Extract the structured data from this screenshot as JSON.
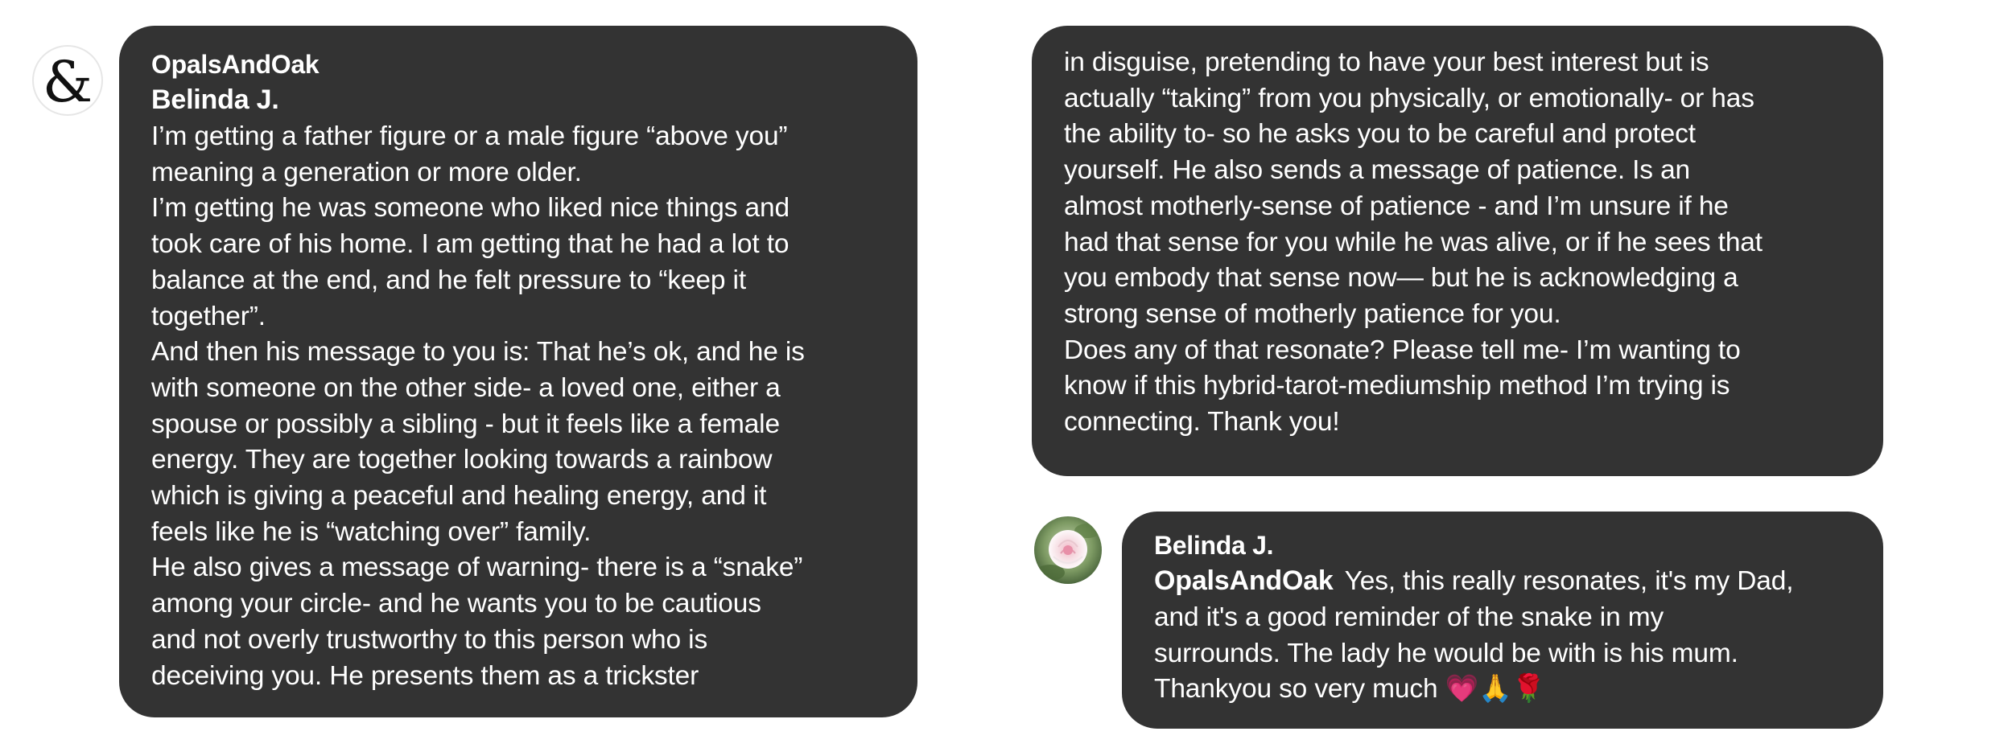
{
  "comments": [
    {
      "avatar_icon": "ampersand-logo-icon",
      "avatar_glyph": "&",
      "author": "OpalsAndOak",
      "mention": "Belinda J.",
      "lines": [
        "I’m getting a father figure or a male figure “above you”",
        "meaning a generation or more older.",
        "I’m getting he was someone who liked nice things and",
        "took care of his home. I am getting that he had a lot to",
        "balance at the end, and he felt pressure to “keep it",
        "together”.",
        "And then his message to you is:  That he’s ok, and he is",
        "with someone on the other side- a loved one, either a",
        "spouse or possibly a sibling - but it feels like a female",
        "energy. They are together looking towards a rainbow",
        "which is giving a peaceful and healing energy, and it",
        "feels like he is “watching over” family.",
        "He also gives a message of warning- there is a “snake”",
        "among your circle- and he wants you to be cautious",
        "and not overly trustworthy to this person who is",
        "deceiving you. He presents them as a trickster"
      ]
    },
    {
      "continuation_lines": [
        "in disguise, pretending to have your best interest but is",
        "actually “taking” from you physically, or emotionally- or has",
        "the ability to- so he asks you to be careful and protect",
        "yourself. He also sends a message of patience. Is an",
        "almost motherly-sense of patience - and I’m unsure if he",
        "had that sense for you while he was alive, or if he sees that",
        "you embody that sense now— but he is acknowledging a",
        "strong sense of motherly patience for you.",
        "Does any of that resonate? Please tell me- I’m wanting to",
        "know if this hybrid-tarot-mediumship method I’m trying is",
        "connecting.  Thank you!"
      ]
    },
    {
      "avatar_icon": "rose-avatar-icon",
      "author": "Belinda J.",
      "mention": "OpalsAndOak",
      "first_line_text": "Yes, this really resonates, it's my Dad,",
      "lines": [
        "and it's a good reminder of the snake in my",
        "surrounds. The lady he would be with is his mum.",
        "Thankyou so very much 💗🙏🌹"
      ]
    }
  ],
  "colors": {
    "bubble": "#333333",
    "text": "#ffffff",
    "background": "#ffffff"
  }
}
